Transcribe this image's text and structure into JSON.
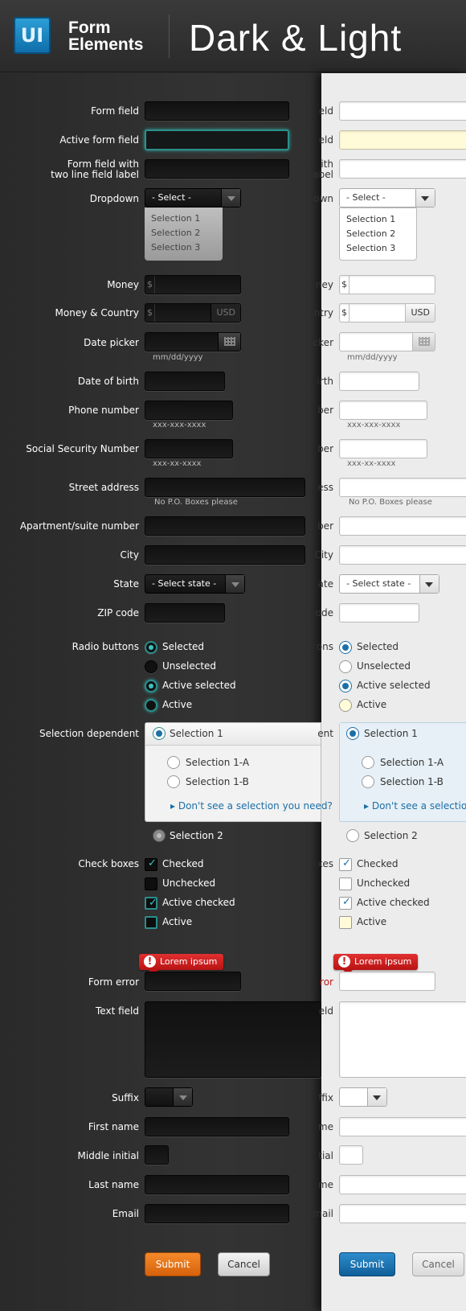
{
  "header": {
    "logo": "UI",
    "title_line1": "Form",
    "title_line2": "Elements",
    "big_title": "Dark & Light"
  },
  "labels": {
    "form_field": "Form field",
    "active_form_field": "Active form field",
    "two_line_1": "Form field with",
    "two_line_2": "two line field label",
    "dropdown": "Dropdown",
    "money": "Money",
    "money_country": "Money & Country",
    "date_picker": "Date picker",
    "dob": "Date of birth",
    "phone": "Phone number",
    "ssn": "Social Security Number",
    "street": "Street address",
    "apt": "Apartment/suite number",
    "city": "City",
    "state": "State",
    "zip": "ZIP code",
    "radio": "Radio buttons",
    "selection_dependent": "Selection dependent",
    "check_boxes": "Check boxes",
    "form_error": "Form error",
    "text_field": "Text field",
    "suffix": "Suffix",
    "first_name": "First name",
    "middle_initial": "Middle initial",
    "last_name": "Last name",
    "email": "Email"
  },
  "light_labels": {
    "form_field": "eld",
    "active_form_field": "eld",
    "two_line_1": "ith",
    "two_line_2": "abel",
    "dropdown": "own",
    "money": "ney",
    "money_country": "ntry",
    "date_picker": "cker",
    "dob": "irth",
    "phone": "ber",
    "ssn": "ber",
    "street": "ess",
    "apt": "ber",
    "city": "City",
    "state": "ate",
    "zip": "ode",
    "radio": "ons",
    "selection_dependent": "ent",
    "check_boxes": "xes",
    "form_error": "ror",
    "text_field": "eld",
    "suffix": "ffix",
    "first_name": "me",
    "middle_initial": "tial",
    "last_name": "me",
    "email": "mail"
  },
  "dropdown": {
    "placeholder": "- Select -",
    "options": [
      "Selection 1",
      "Selection 2",
      "Selection 3"
    ]
  },
  "money": {
    "prefix": "$",
    "currency": "USD"
  },
  "hints": {
    "date": "mm/dd/yyyy",
    "phone": "xxx-xxx-xxxx",
    "ssn": "xxx-xx-xxxx",
    "street": "No P.O. Boxes please"
  },
  "state_select": "- Select state -",
  "radios": [
    "Selected",
    "Unselected",
    "Active selected",
    "Active"
  ],
  "selection_dependent": {
    "option1": "Selection 1",
    "sub1": "Selection 1-A",
    "sub2": "Selection 1-B",
    "link": "Don't see a selection you need?",
    "link_light": "Don't see a selection y",
    "option2": "Selection 2"
  },
  "checkboxes": [
    "Checked",
    "Unchecked",
    "Active checked",
    "Active"
  ],
  "error": {
    "message": "Lorem ipsum"
  },
  "buttons": {
    "submit": "Submit",
    "cancel": "Cancel"
  },
  "colors": {
    "dark_accent": "#2b8f8c",
    "light_accent": "#1e6fa8",
    "dark_submit": "#e5761b",
    "light_submit": "#1f76b4",
    "error": "#c01a1a"
  }
}
